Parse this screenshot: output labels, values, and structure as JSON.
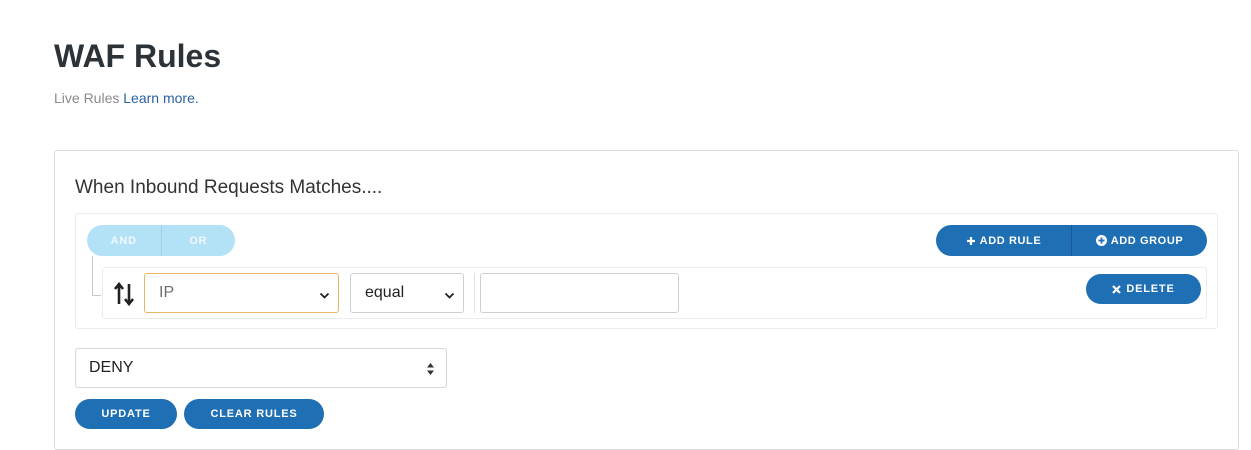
{
  "page": {
    "title": "WAF Rules",
    "subtitle_text": "Live Rules",
    "learn_more": "Learn more."
  },
  "query_builder": {
    "heading": "When Inbound Requests Matches....",
    "conjunctions": [
      "AND",
      "OR"
    ],
    "add_rule_label": "ADD RULE",
    "add_group_label": "ADD GROUP",
    "rule": {
      "field": "IP",
      "operator": "equal",
      "value": "",
      "delete_label": "DELETE"
    }
  },
  "action": {
    "selected": "DENY"
  },
  "buttons": {
    "update": "UPDATE",
    "clear_rules": "CLEAR RULES"
  },
  "colors": {
    "primary": "#1f6fb5",
    "conjunction_bg": "#b3e1f6",
    "field_border": "#e6b566"
  },
  "icons": {
    "add_rule": "plus-icon",
    "add_group": "plus-circle-icon",
    "delete": "close-icon",
    "drag": "sort-arrows-icon",
    "select": "chevron-down-icon",
    "action_select": "up-down-arrows-icon"
  }
}
